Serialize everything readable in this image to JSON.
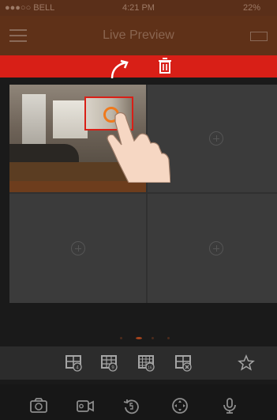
{
  "status": {
    "carrier": "●●●○○ BELL",
    "time": "4:21 PM",
    "battery": "22%"
  },
  "header": {
    "title": "Live Preview"
  },
  "delete_bar": {
    "label": ""
  },
  "toolbar": {
    "labels": [
      "4",
      "9",
      "16",
      "",
      ""
    ]
  },
  "colors": {
    "accent": "#d81f17",
    "nav": "#5f3118",
    "dark": "#171717"
  },
  "icons": {
    "menu": "menu-icon",
    "trash": "trash-icon",
    "grid": "grid-icon",
    "favorite": "star-icon",
    "camera": "camera-icon",
    "video": "video-icon",
    "replay": "replay-icon",
    "joystick": "joystick-icon",
    "mic": "microphone-icon"
  }
}
